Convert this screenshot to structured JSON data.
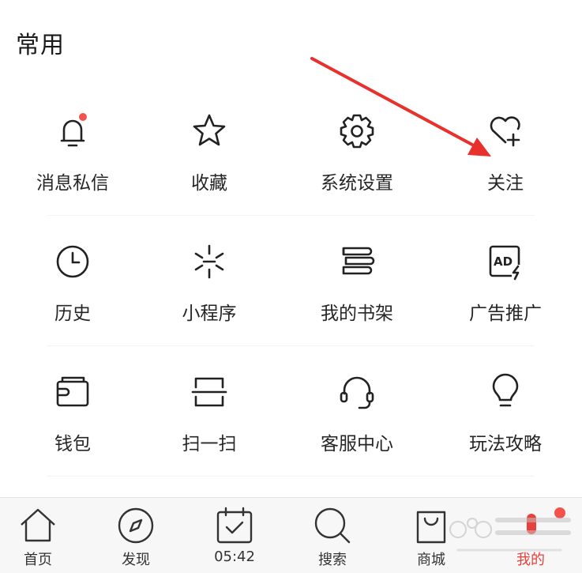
{
  "section": {
    "title": "常用"
  },
  "grid": {
    "rows": [
      [
        {
          "label": "消息私信",
          "icon": "bell-icon",
          "badge": true
        },
        {
          "label": "收藏",
          "icon": "star-icon"
        },
        {
          "label": "系统设置",
          "icon": "gear-icon"
        },
        {
          "label": "关注",
          "icon": "heart-plus-icon"
        }
      ],
      [
        {
          "label": "历史",
          "icon": "clock-icon"
        },
        {
          "label": "小程序",
          "icon": "mini-program-icon"
        },
        {
          "label": "我的书架",
          "icon": "books-icon"
        },
        {
          "label": "广告推广",
          "icon": "ad-icon"
        }
      ],
      [
        {
          "label": "钱包",
          "icon": "wallet-icon"
        },
        {
          "label": "扫一扫",
          "icon": "scan-icon"
        },
        {
          "label": "客服中心",
          "icon": "headset-icon"
        },
        {
          "label": "玩法攻略",
          "icon": "bulb-icon"
        }
      ]
    ]
  },
  "tabbar": {
    "tabs": [
      {
        "label": "首页",
        "icon": "home-icon"
      },
      {
        "label": "发现",
        "icon": "compass-icon"
      },
      {
        "label": "05:42",
        "icon": "calendar-check-icon"
      },
      {
        "label": "搜索",
        "icon": "search-icon"
      },
      {
        "label": "商城",
        "icon": "shopping-bag-icon"
      },
      {
        "label": "我的",
        "icon": "profile-icon",
        "active": true
      }
    ]
  },
  "colors": {
    "accent": "#e8403a",
    "badge": "#f2544d",
    "arrow": "#e8312c"
  }
}
